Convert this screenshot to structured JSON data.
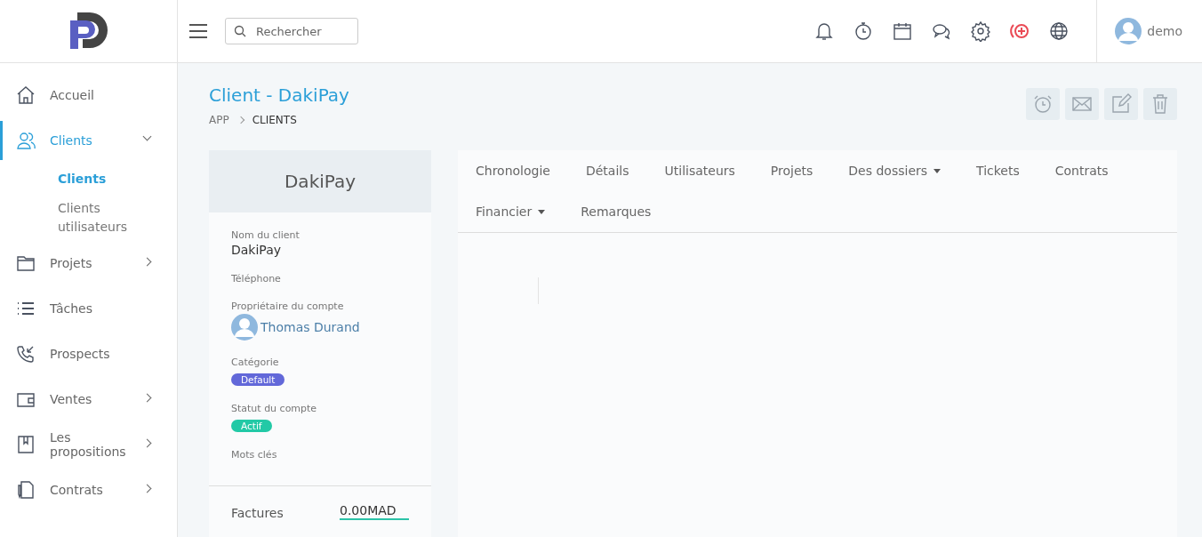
{
  "search": {
    "placeholder": "Rechercher"
  },
  "top_icons": [
    {
      "kind": "bell"
    },
    {
      "kind": "timer"
    },
    {
      "kind": "calendar"
    },
    {
      "kind": "chat"
    },
    {
      "kind": "gear"
    },
    {
      "kind": "plus-alert"
    },
    {
      "kind": "globe"
    }
  ],
  "user": {
    "name": "demo"
  },
  "sidebar": {
    "items": [
      {
        "kind": "home",
        "label": "Accueil",
        "selected": false,
        "expandable": false
      },
      {
        "kind": "users",
        "label": "Clients",
        "selected": true,
        "expandable": true,
        "expanded": true,
        "children": [
          {
            "label": "Clients",
            "selected": true
          },
          {
            "label": "Clients utilisateurs",
            "selected": false
          }
        ]
      },
      {
        "kind": "folder",
        "label": "Projets",
        "selected": false,
        "expandable": true,
        "expanded": false
      },
      {
        "kind": "list",
        "label": "Tâches",
        "selected": false,
        "expandable": false
      },
      {
        "kind": "phone",
        "label": "Prospects",
        "selected": false,
        "expandable": false
      },
      {
        "kind": "wallet",
        "label": "Ventes",
        "selected": false,
        "expandable": true,
        "expanded": false
      },
      {
        "kind": "book",
        "label": "Les propositions",
        "selected": false,
        "expandable": true,
        "expanded": false
      },
      {
        "kind": "file",
        "label": "Contrats",
        "selected": false,
        "expandable": true,
        "expanded": false
      }
    ]
  },
  "page": {
    "title": "Client - DakiPay",
    "breadcrumb": [
      "APP",
      "CLIENTS"
    ],
    "actions": [
      {
        "kind": "alarm"
      },
      {
        "kind": "mail"
      },
      {
        "kind": "edit"
      },
      {
        "kind": "trash"
      }
    ]
  },
  "client_card": {
    "name": "DakiPay",
    "fields": [
      {
        "kind": "text",
        "label": "Nom du client",
        "value": "DakiPay"
      },
      {
        "kind": "empty",
        "label": "Téléphone"
      },
      {
        "kind": "owner",
        "label": "Propriétaire du compte",
        "value": "Thomas Durand"
      },
      {
        "kind": "badge",
        "label": "Catégorie",
        "value": "Default",
        "color": "#6268d9"
      },
      {
        "kind": "badge",
        "label": "Statut du compte",
        "value": "Actif",
        "color": "#22c9a6"
      },
      {
        "kind": "empty",
        "label": "Mots clés"
      }
    ],
    "summary": [
      {
        "label": "Factures",
        "value": "0.00MAD"
      }
    ]
  },
  "tabs": [
    {
      "label": "Chronologie",
      "dropdown": false
    },
    {
      "label": "Détails",
      "dropdown": false
    },
    {
      "label": "Utilisateurs",
      "dropdown": false
    },
    {
      "label": "Projets",
      "dropdown": false
    },
    {
      "label": "Des dossiers",
      "dropdown": true
    },
    {
      "label": "Tickets",
      "dropdown": false
    },
    {
      "label": "Contrats",
      "dropdown": false
    },
    {
      "label": "Financier",
      "dropdown": true
    },
    {
      "label": "Remarques",
      "dropdown": false
    }
  ]
}
